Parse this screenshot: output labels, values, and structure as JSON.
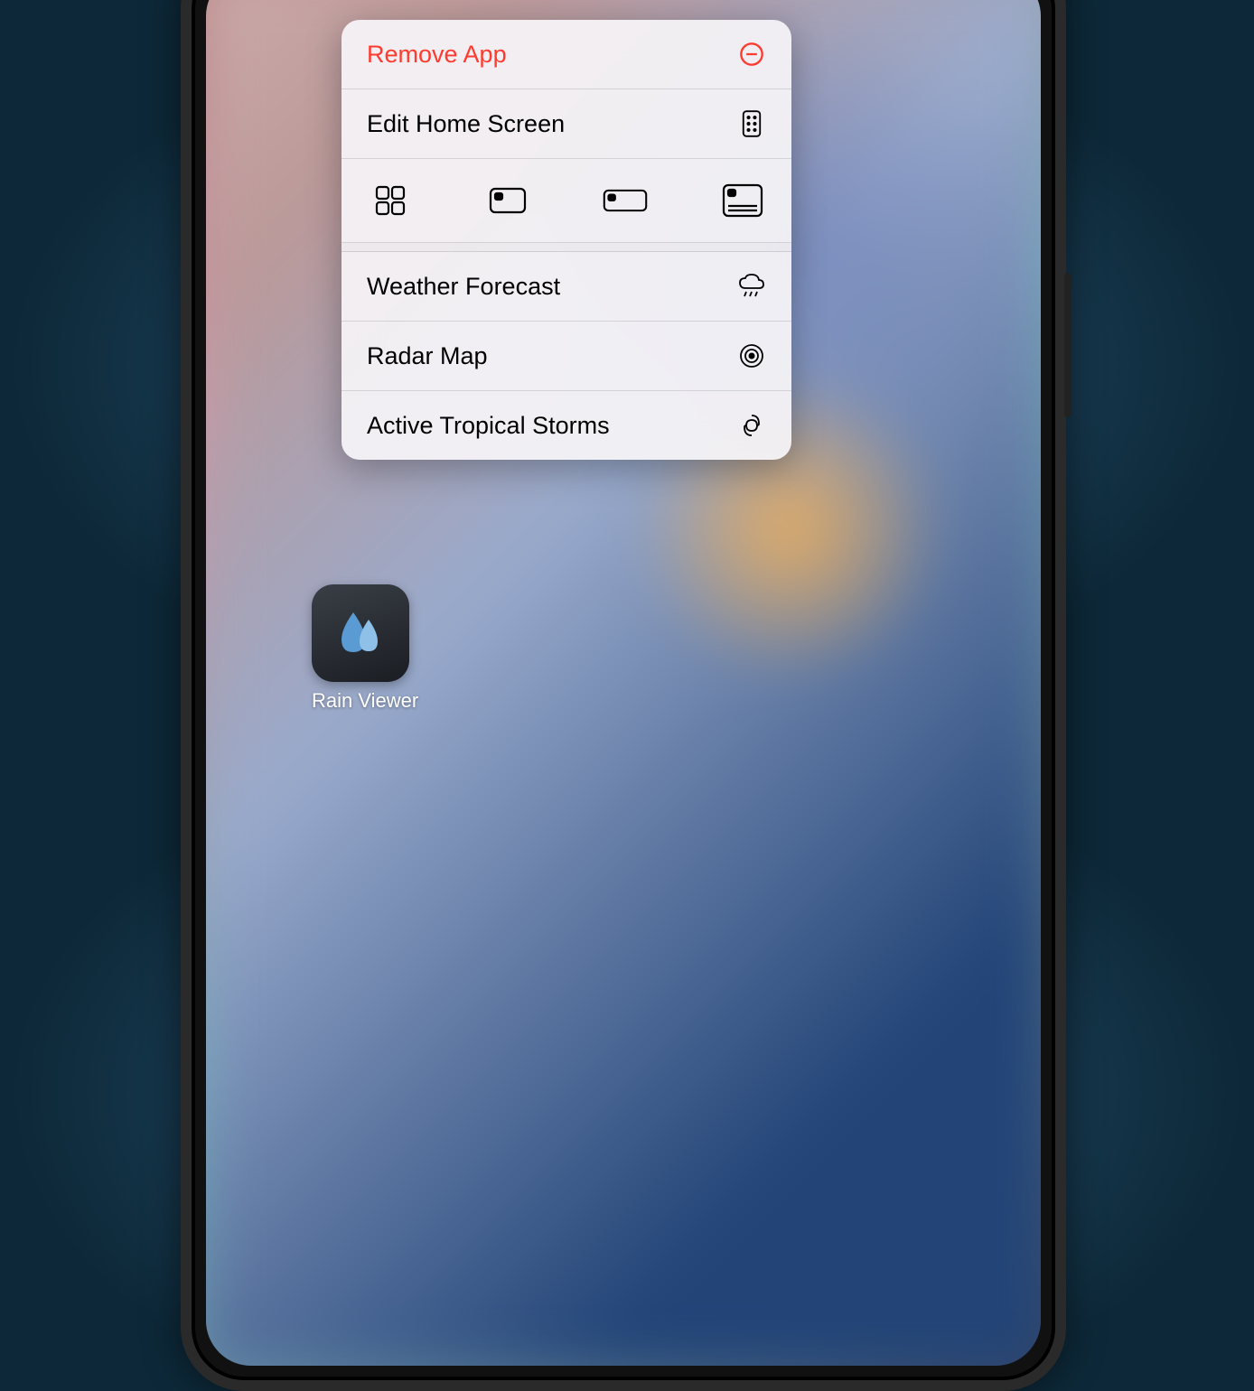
{
  "context_menu": {
    "remove_app": "Remove App",
    "edit_home_screen": "Edit Home Screen",
    "actions": {
      "weather_forecast": "Weather Forecast",
      "radar_map": "Radar Map",
      "active_tropical_storms": "Active Tropical Storms"
    }
  },
  "app": {
    "name": "Rain Viewer"
  },
  "colors": {
    "destructive": "#ff3b30"
  }
}
